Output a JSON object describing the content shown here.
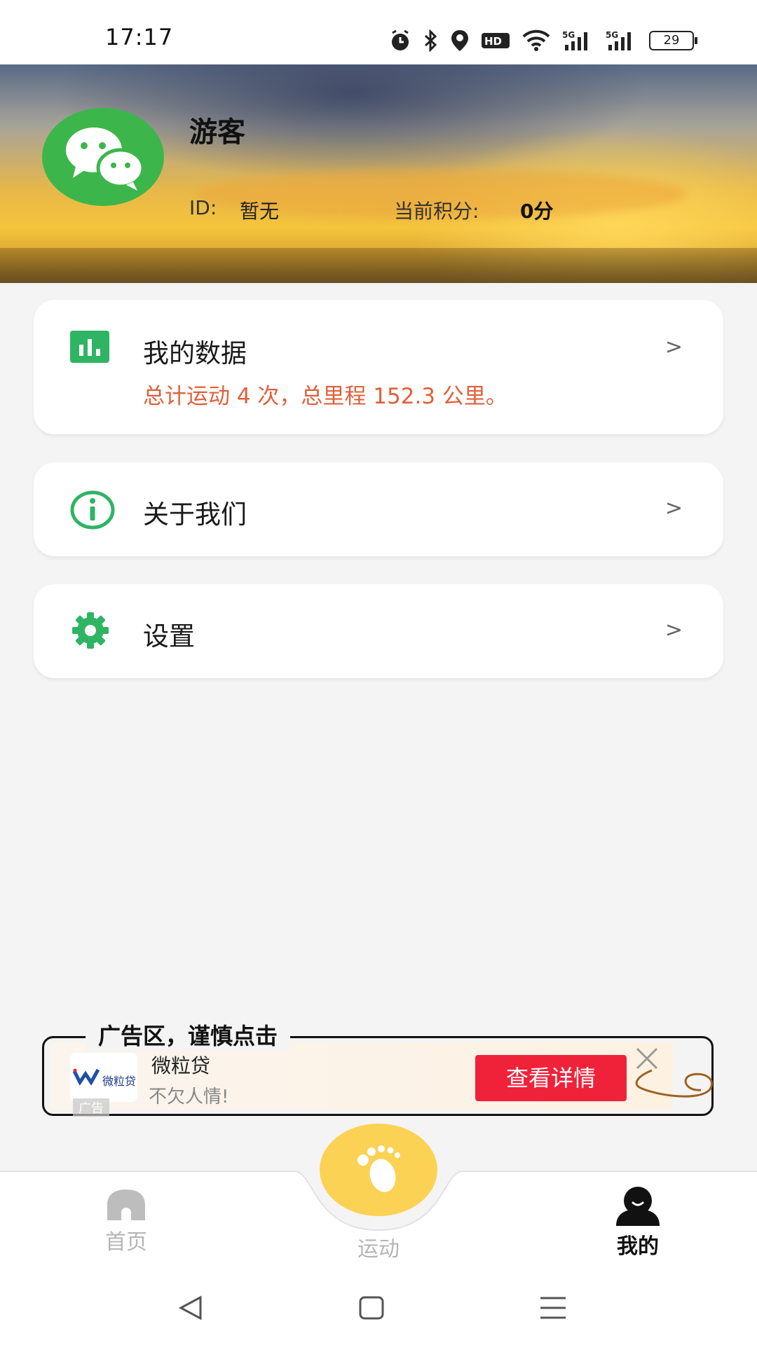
{
  "status_bar": {
    "time": "17:17",
    "battery": "29",
    "icons": [
      "alarm-icon",
      "bluetooth-icon",
      "location-icon",
      "hd-icon",
      "wifi-icon",
      "signal-5g-icon",
      "signal-5g-icon"
    ]
  },
  "profile": {
    "name": "游客",
    "id_label": "ID:",
    "id_value": "暂无",
    "points_label": "当前积分:",
    "points_value": "0分"
  },
  "menu": {
    "my_data": {
      "label": "我的数据",
      "summary": "总计运动 4 次，总里程 152.3 公里。"
    },
    "about": {
      "label": "关于我们"
    },
    "settings": {
      "label": "设置"
    },
    "chevron": ">"
  },
  "ad": {
    "caption": "广告区，谨慎点击",
    "logo_text": "微粒贷",
    "tag": "广告",
    "title": "微粒贷",
    "desc": "不欠人情!",
    "button": "查看详情"
  },
  "bottom_nav": {
    "home": "首页",
    "sport": "运动",
    "mine": "我的",
    "active": "mine"
  },
  "colors": {
    "accent_green": "#2fb464",
    "summary_orange": "#e0603a",
    "fab_yellow": "#fbd254",
    "ad_button_red": "#f0223a"
  }
}
